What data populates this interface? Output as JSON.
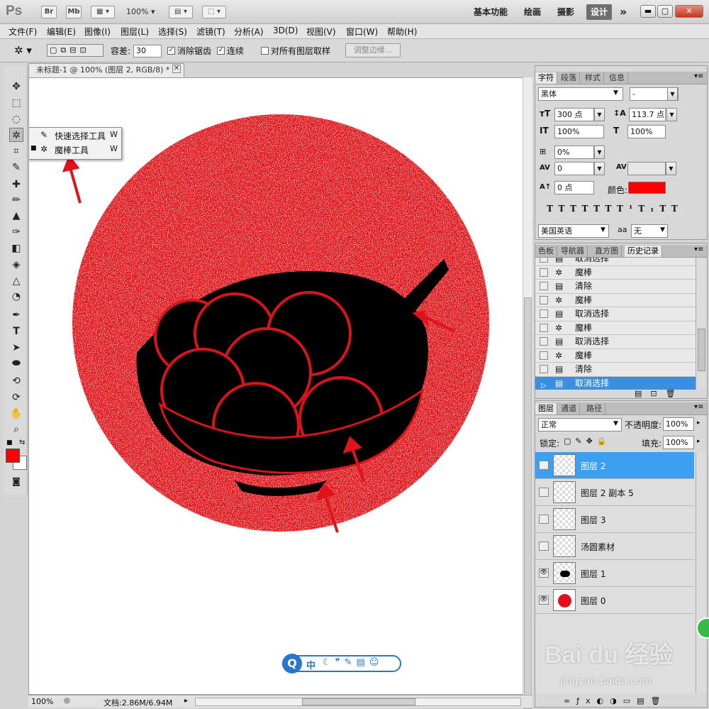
{
  "titlebar": {
    "app_logo": "Ps",
    "bridge_label": "Br",
    "minibridge_label": "Mb",
    "zoom": "100%",
    "workspaces": [
      "基本功能",
      "绘画",
      "摄影",
      "设计"
    ],
    "active_workspace": "设计",
    "more_workspaces": "»"
  },
  "menu": [
    "文件(F)",
    "编辑(E)",
    "图像(I)",
    "图层(L)",
    "选择(S)",
    "滤镜(T)",
    "分析(A)",
    "3D(D)",
    "视图(V)",
    "窗口(W)",
    "帮助(H)"
  ],
  "options": {
    "tolerance_label": "容差:",
    "tolerance_value": "30",
    "antialias_label": "消除锯齿",
    "contiguous_label": "连续",
    "sample_all_label": "对所有图层取样",
    "refine_edge_label": "调整边缘..."
  },
  "tool_flyout": [
    {
      "label": "快速选择工具",
      "key": "W"
    },
    {
      "label": "魔棒工具",
      "key": "W"
    }
  ],
  "document": {
    "tab_title": "未标题-1 @ 100% (图层 2, RGB/8) *",
    "zoom": "100%",
    "doc_size": "文档:2.86M/6.94M"
  },
  "character_panel": {
    "tabs": [
      "字符",
      "段落",
      "样式",
      "信息"
    ],
    "font_family": "黑体",
    "font_style": "-",
    "font_size": "300 点",
    "leading": "113.7 点",
    "vertical_scale": "100%",
    "horizontal_scale": "100%",
    "tracking_pct": "0%",
    "kerning": "0",
    "baseline_shift": "0 点",
    "color_label": "颜色:",
    "color": "#ff0000",
    "language": "美国英语",
    "antialias_label": "aa",
    "antialias": "无"
  },
  "history_panel": {
    "tabs": [
      "色板",
      "导航器",
      "直方图",
      "历史记录"
    ],
    "items": [
      "取消选择",
      "魔棒",
      "清除",
      "魔棒",
      "取消选择",
      "魔棒",
      "取消选择",
      "魔棒",
      "清除",
      "取消选择"
    ]
  },
  "layers_panel": {
    "tabs": [
      "图层",
      "通道",
      "路径"
    ],
    "blend_mode": "正常",
    "opacity_label": "不透明度:",
    "opacity": "100%",
    "lock_label": "锁定:",
    "fill_label": "填充:",
    "fill": "100%",
    "layers": [
      {
        "name": "图层 2",
        "visible": true
      },
      {
        "name": "图层 2 副本 5",
        "visible": false
      },
      {
        "name": "图层 3",
        "visible": false
      },
      {
        "name": "汤圆素材",
        "visible": false
      },
      {
        "name": "图层 1",
        "visible": true
      },
      {
        "name": "图层 0",
        "visible": true
      }
    ]
  },
  "ime_bar": {
    "logo": "Q",
    "mode": "中"
  },
  "watermark": {
    "brand": "Bai du 经验",
    "url": "jingyan.baidu.com"
  },
  "colors": {
    "foreground": "#ff0000",
    "background": "#ffffff",
    "accent_selected": "#3d9ff0",
    "circle_red": "#e2121a"
  }
}
